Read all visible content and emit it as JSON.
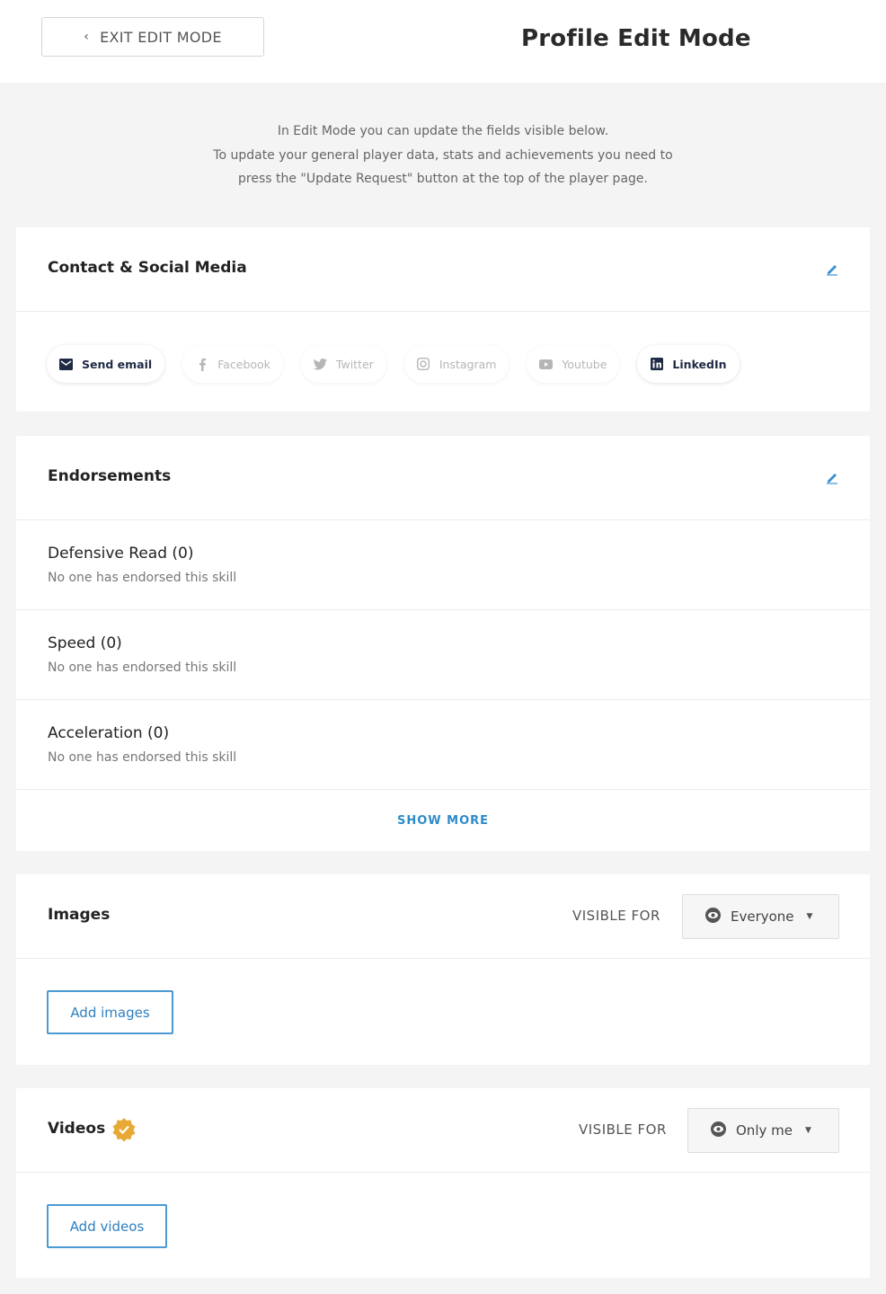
{
  "header": {
    "exit_label": "EXIT EDIT MODE",
    "page_title": "Profile Edit Mode"
  },
  "intro": {
    "line1": "In Edit Mode you can update the fields visible below.",
    "line2": "To update your general player data, stats and achievements you need to",
    "line3": "press the \"Update Request\" button at the top of the player page."
  },
  "contact": {
    "title": "Contact & Social Media",
    "items": [
      {
        "label": "Send email",
        "icon": "envelope-icon",
        "active": true
      },
      {
        "label": "Facebook",
        "icon": "facebook-icon",
        "active": false
      },
      {
        "label": "Twitter",
        "icon": "twitter-icon",
        "active": false
      },
      {
        "label": "Instagram",
        "icon": "instagram-icon",
        "active": false
      },
      {
        "label": "Youtube",
        "icon": "youtube-icon",
        "active": false
      },
      {
        "label": "LinkedIn",
        "icon": "linkedin-icon",
        "active": true
      }
    ]
  },
  "endorsements": {
    "title": "Endorsements",
    "items": [
      {
        "name": "Defensive Read (0)",
        "sub": "No one has endorsed this skill"
      },
      {
        "name": "Speed (0)",
        "sub": "No one has endorsed this skill"
      },
      {
        "name": "Acceleration (0)",
        "sub": "No one has endorsed this skill"
      }
    ],
    "show_more": "SHOW MORE"
  },
  "images": {
    "title": "Images",
    "visible_for_label": "VISIBLE FOR",
    "visibility": "Everyone",
    "add_label": "Add images"
  },
  "videos": {
    "title": "Videos",
    "visible_for_label": "VISIBLE FOR",
    "visibility": "Only me",
    "add_label": "Add videos"
  },
  "colors": {
    "accent": "#2d8bc9",
    "badge": "#e8a935",
    "background": "#f4f4f4"
  }
}
